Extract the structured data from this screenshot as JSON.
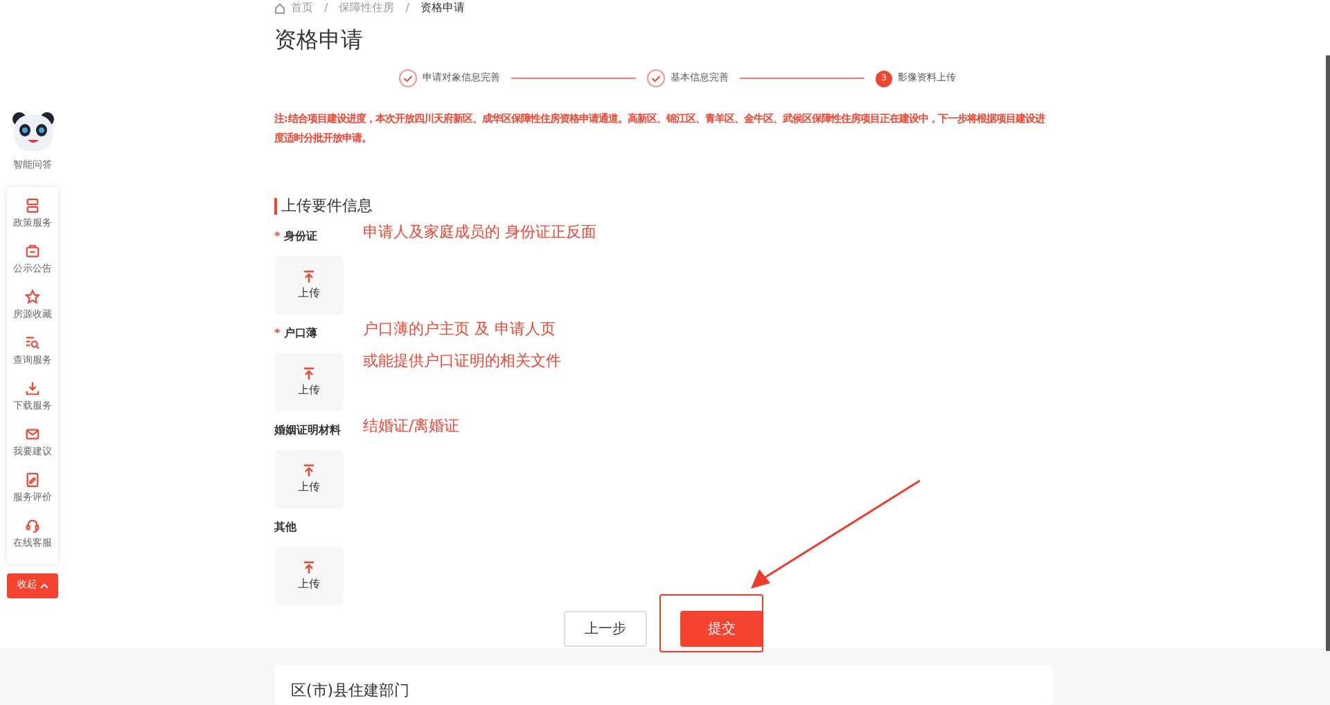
{
  "breadcrumb": [
    {
      "label": "首页"
    },
    {
      "separator": "/",
      "label": "保障性住房"
    },
    {
      "separator": "/",
      "label": "资格申请"
    }
  ],
  "title": "资格申请",
  "steps": [
    {
      "label": "申请对象信息完善",
      "completed": true
    },
    {
      "label": "基本信息完善",
      "completed": true
    },
    {
      "number": "3",
      "label": "影像资料上传",
      "completed": false
    }
  ],
  "notice": "注:结合项目建设进度，本次开放四川天府新区、成华区保障性住房资格申请通道。高新区、锦江区、青羊区、金牛区、武侯区保障性住房项目正在建设中，下一步将根据项目建设进度适时分批开放申请。",
  "section_title": "上传要件信息",
  "fields": [
    {
      "label": "身份证",
      "required_mark": "*",
      "upload_label": "上传",
      "annotations": [
        "申请人及家庭成员的 身份证正反面"
      ]
    },
    {
      "label": "户口薄",
      "required_mark": "*",
      "upload_label": "上传",
      "annotations": [
        "户口薄的户主页 及 申请人页",
        "或能提供户口证明的相关文件"
      ]
    },
    {
      "label": "婚姻证明材料",
      "upload_label": "上传",
      "annotations": [
        "结婚证/离婚证"
      ]
    },
    {
      "label": "其他",
      "upload_label": "上传"
    }
  ],
  "buttons": {
    "previous": "上一步",
    "submit": "提交"
  },
  "sidebar": {
    "assistant_label": "智能问答",
    "items": [
      "政策服务",
      "公示公告",
      "房源收藏",
      "查询服务",
      "下载服务",
      "我要建议",
      "服务评价",
      "在线客服"
    ],
    "collapse": "收起"
  },
  "footer_card": {
    "title": "区(市)县住建部门"
  }
}
